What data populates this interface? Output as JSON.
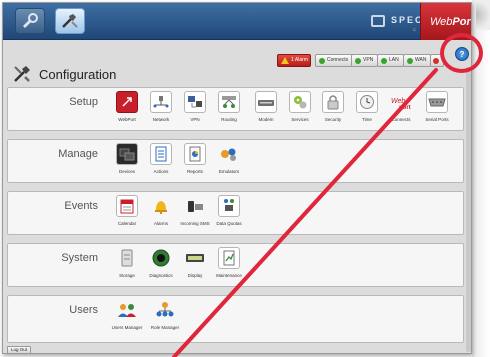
{
  "topbar": {
    "brand": "SPECTRUM",
    "brand_sub": "CONTROLS",
    "logo_web": "Web",
    "logo_port": "Port"
  },
  "status": {
    "alarm": "1 Alarm",
    "connects": "Connects",
    "vpn": "VPN",
    "lan": "LAN",
    "wan": "WAN",
    "help": "?",
    "colors": {
      "alarm": "#d0312d",
      "ok": "#37a52b",
      "err": "#d0312d"
    }
  },
  "page": {
    "title": "Configuration"
  },
  "sections": {
    "setup": {
      "label": "Setup",
      "items": [
        "WebPort",
        "Network",
        "VPN",
        "Routing",
        "Modem",
        "Services",
        "Security",
        "Time",
        "Connects",
        "Serial Ports"
      ]
    },
    "manage": {
      "label": "Manage",
      "items": [
        "Devices",
        "Actions",
        "Reports",
        "Emulators"
      ]
    },
    "events": {
      "label": "Events",
      "items": [
        "Calendar",
        "Alarms",
        "Incoming SMS",
        "Data Quotas"
      ]
    },
    "system": {
      "label": "System",
      "items": [
        "Storage",
        "Diagnostics",
        "Display",
        "Maintenance"
      ]
    },
    "users": {
      "label": "Users",
      "items": [
        "Users Manager",
        "Role Manager"
      ]
    }
  },
  "footer": {
    "logout": "Log Out"
  },
  "annotation_color": "#e0263b"
}
